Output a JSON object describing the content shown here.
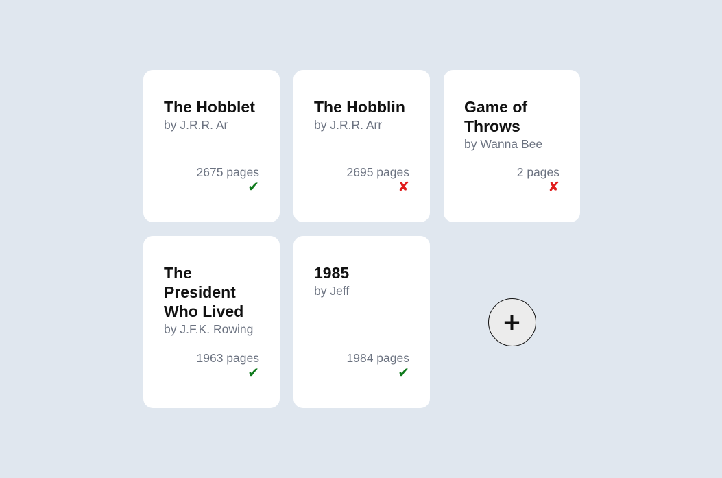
{
  "books": [
    {
      "title": "The Hobblet",
      "author": "by J.R.R. Ar",
      "pages": "2675 pages",
      "status_icon": "✔",
      "status": "read"
    },
    {
      "title": "The Hobblin",
      "author": "by J.R.R. Arr",
      "pages": "2695 pages",
      "status_icon": "✘",
      "status": "unread"
    },
    {
      "title": "Game of Throws",
      "author": "by Wanna Bee",
      "pages": "2 pages",
      "status_icon": "✘",
      "status": "unread"
    },
    {
      "title": "The President Who Lived",
      "author": "by J.F.K. Rowing",
      "pages": "1963 pages",
      "status_icon": "✔",
      "status": "read"
    },
    {
      "title": "1985",
      "author": "by Jeff",
      "pages": "1984 pages",
      "status_icon": "✔",
      "status": "read"
    }
  ],
  "add_button": {
    "label": "+",
    "icon": "plus-icon"
  },
  "colors": {
    "background": "#e0e7ef",
    "card": "#ffffff",
    "read": "#0f7a1c",
    "unread": "#e11d1d",
    "muted_text": "#6b7280"
  }
}
